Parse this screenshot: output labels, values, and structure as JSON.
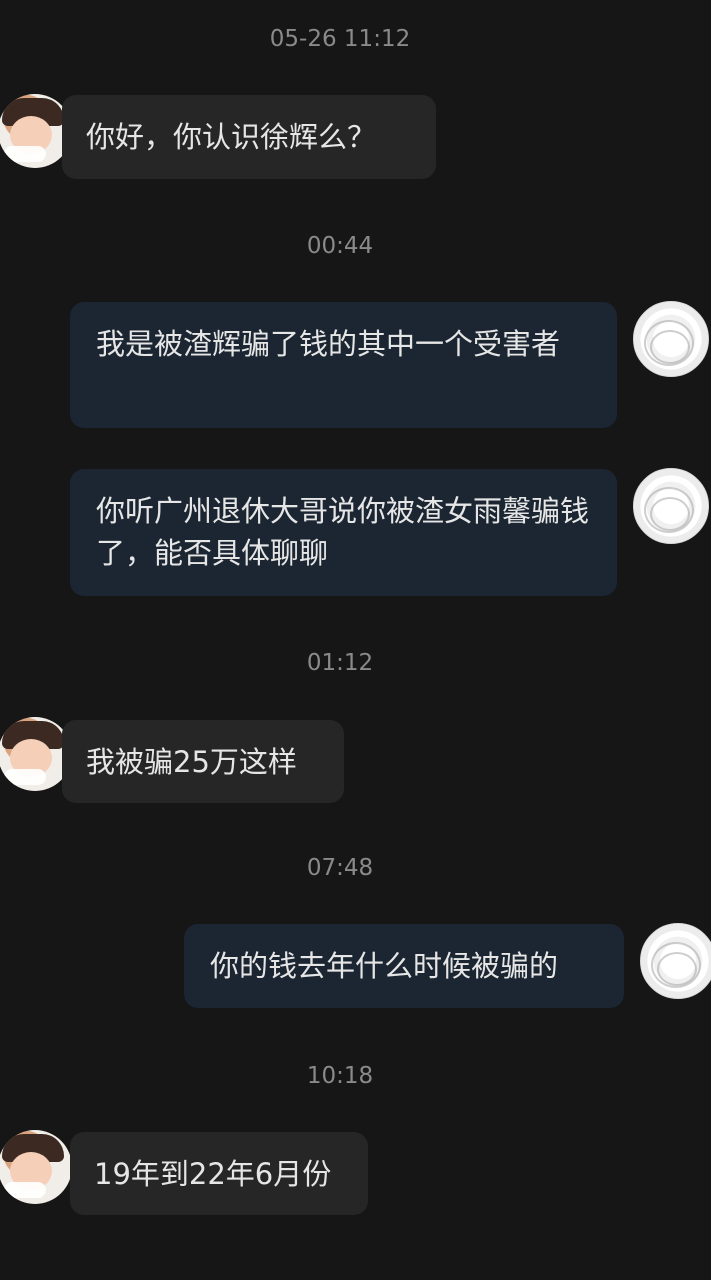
{
  "chat": {
    "messages": [
      {
        "time": "05-26 11:12",
        "sender": "other",
        "text": "你好，你认识徐辉么？"
      },
      {
        "time": "00:44",
        "sender": "me",
        "text": "我是被渣辉骗了钱的其中一个受害者"
      },
      {
        "sender": "me",
        "text": "你听广州退休大哥说你被渣女雨馨骗钱了，能否具体聊聊"
      },
      {
        "time": "01:12",
        "sender": "other",
        "text": "我被骗25万这样"
      },
      {
        "time": "07:48",
        "sender": "me",
        "text": "你的钱去年什么时候被骗的"
      },
      {
        "time": "10:18",
        "sender": "other",
        "text": "19年到22年6月份"
      }
    ]
  }
}
